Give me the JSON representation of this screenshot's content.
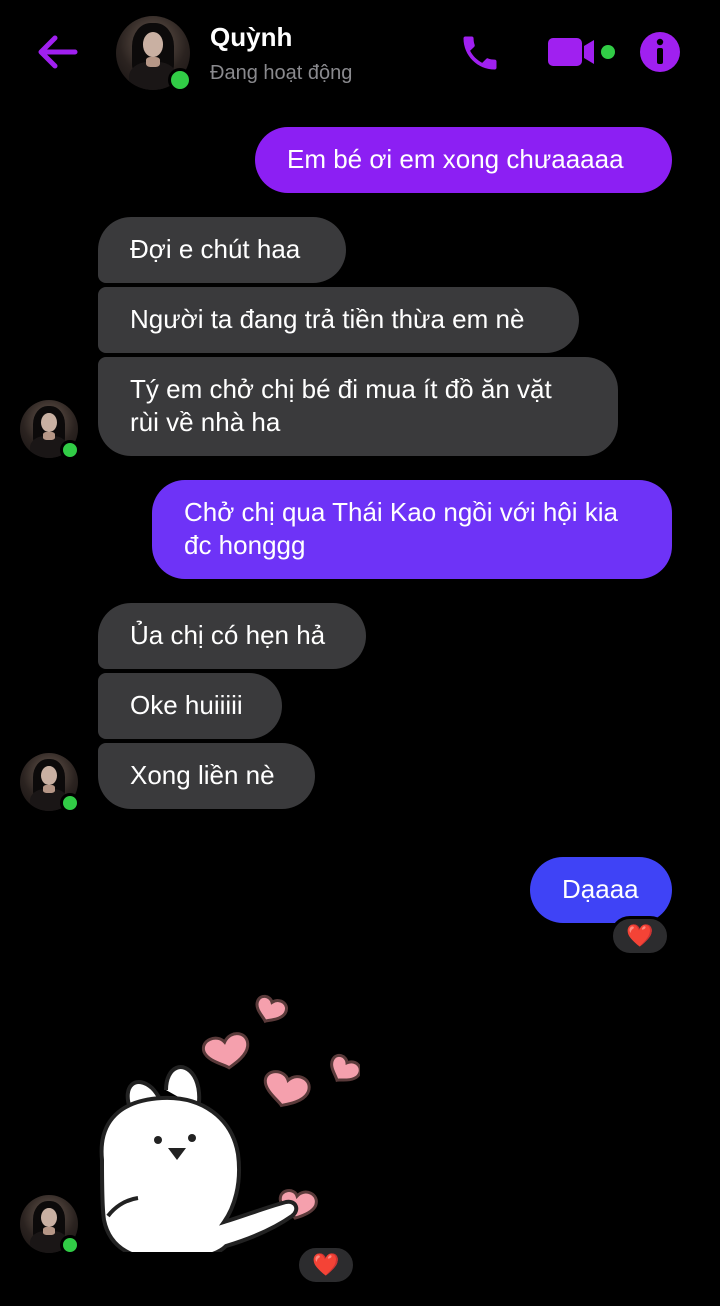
{
  "header": {
    "contact_name": "Quỳnh",
    "status": "Đang hoạt động",
    "accent_color": "#a020f0",
    "online_color": "#31cc46",
    "icons": [
      "back-arrow-icon",
      "phone-icon",
      "video-camera-icon",
      "info-icon"
    ]
  },
  "messages": [
    {
      "sender": "me",
      "text": "Em bé ơi em xong chưaaaaa"
    },
    {
      "sender": "them",
      "text": "Đợi e chút haa"
    },
    {
      "sender": "them",
      "text": "Người ta đang trả tiền thừa em nè"
    },
    {
      "sender": "them",
      "text": "Tý em chở chị bé đi mua ít đồ ăn vặt\nrùi về nhà ha"
    },
    {
      "sender": "me",
      "text": "Chở chị qua Thái Kao ngồi với hội kia\nđc honggg"
    },
    {
      "sender": "them",
      "text": "Ủa chị có hẹn hả"
    },
    {
      "sender": "them",
      "text": "Oke huiiiii"
    },
    {
      "sender": "them",
      "text": "Xong liền nè"
    },
    {
      "sender": "me",
      "text": "Dạaaa",
      "reaction": "❤️"
    },
    {
      "sender": "them",
      "type": "sticker",
      "sticker": "bunny-hearts",
      "reaction": "❤️"
    }
  ],
  "reactions": {
    "daaaa": "❤️",
    "sticker": "❤️"
  }
}
